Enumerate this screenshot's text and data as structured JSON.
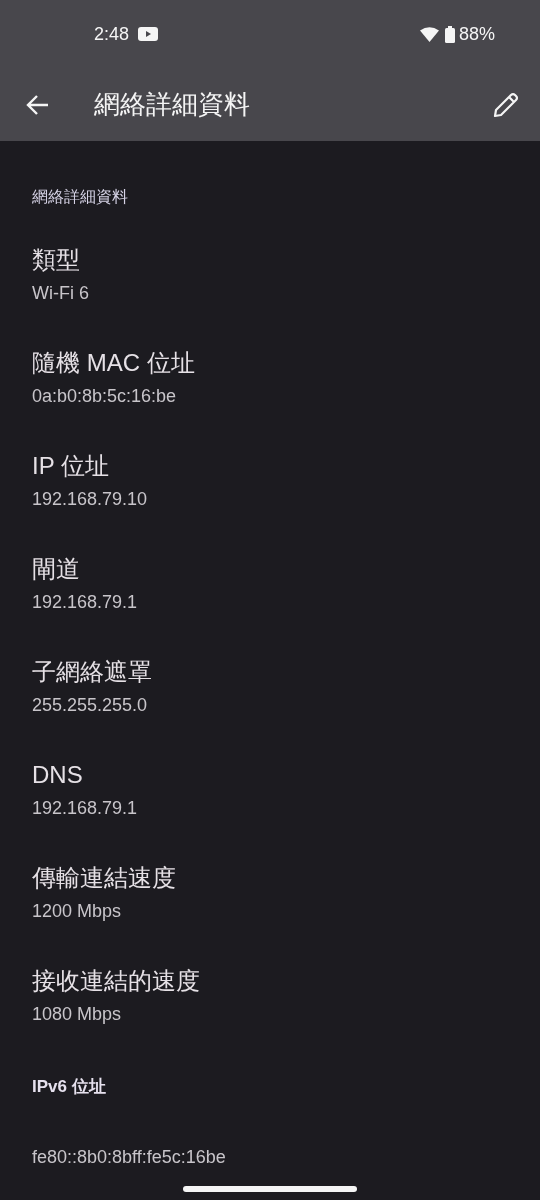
{
  "status_bar": {
    "time": "2:48",
    "battery": "88%"
  },
  "toolbar": {
    "title": "網絡詳細資料"
  },
  "section_header": "網絡詳細資料",
  "details": [
    {
      "title": "類型",
      "value": "Wi-Fi 6"
    },
    {
      "title": "隨機 MAC 位址",
      "value": "0a:b0:8b:5c:16:be"
    },
    {
      "title": "IP 位址",
      "value": "192.168.79.10"
    },
    {
      "title": "閘道",
      "value": "192.168.79.1"
    },
    {
      "title": "子網絡遮罩",
      "value": "255.255.255.0"
    },
    {
      "title": "DNS",
      "value": "192.168.79.1"
    },
    {
      "title": "傳輸連結速度",
      "value": "1200 Mbps"
    },
    {
      "title": "接收連結的速度",
      "value": "1080 Mbps"
    }
  ],
  "ipv6": {
    "header": "IPv6 位址",
    "value": "fe80::8b0:8bff:fe5c:16be"
  }
}
